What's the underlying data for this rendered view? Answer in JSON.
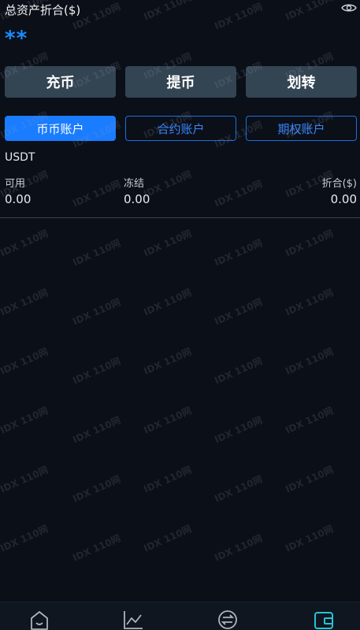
{
  "header": {
    "total_label": "总资产折合($)",
    "balance_masked": "**",
    "visibility_icon": "eye-icon"
  },
  "actions": [
    {
      "label": "充币"
    },
    {
      "label": "提币"
    },
    {
      "label": "划转"
    }
  ],
  "account_tabs": [
    {
      "label": "币币账户",
      "active": true
    },
    {
      "label": "合约账户",
      "active": false
    },
    {
      "label": "期权账户",
      "active": false
    }
  ],
  "assets": [
    {
      "name": "USDT",
      "available_label": "可用",
      "available_value": "0.00",
      "frozen_label": "冻结",
      "frozen_value": "0.00",
      "converted_label": "折合($)",
      "converted_value": "0.00"
    }
  ],
  "watermark": "IDX 110网",
  "tabbar": [
    {
      "icon": "home-icon"
    },
    {
      "icon": "chart-icon"
    },
    {
      "icon": "exchange-icon"
    },
    {
      "icon": "wallet-icon",
      "active": true
    }
  ],
  "colors": {
    "background": "#0b0f18",
    "accent": "#1a7cff",
    "button": "#334453"
  }
}
